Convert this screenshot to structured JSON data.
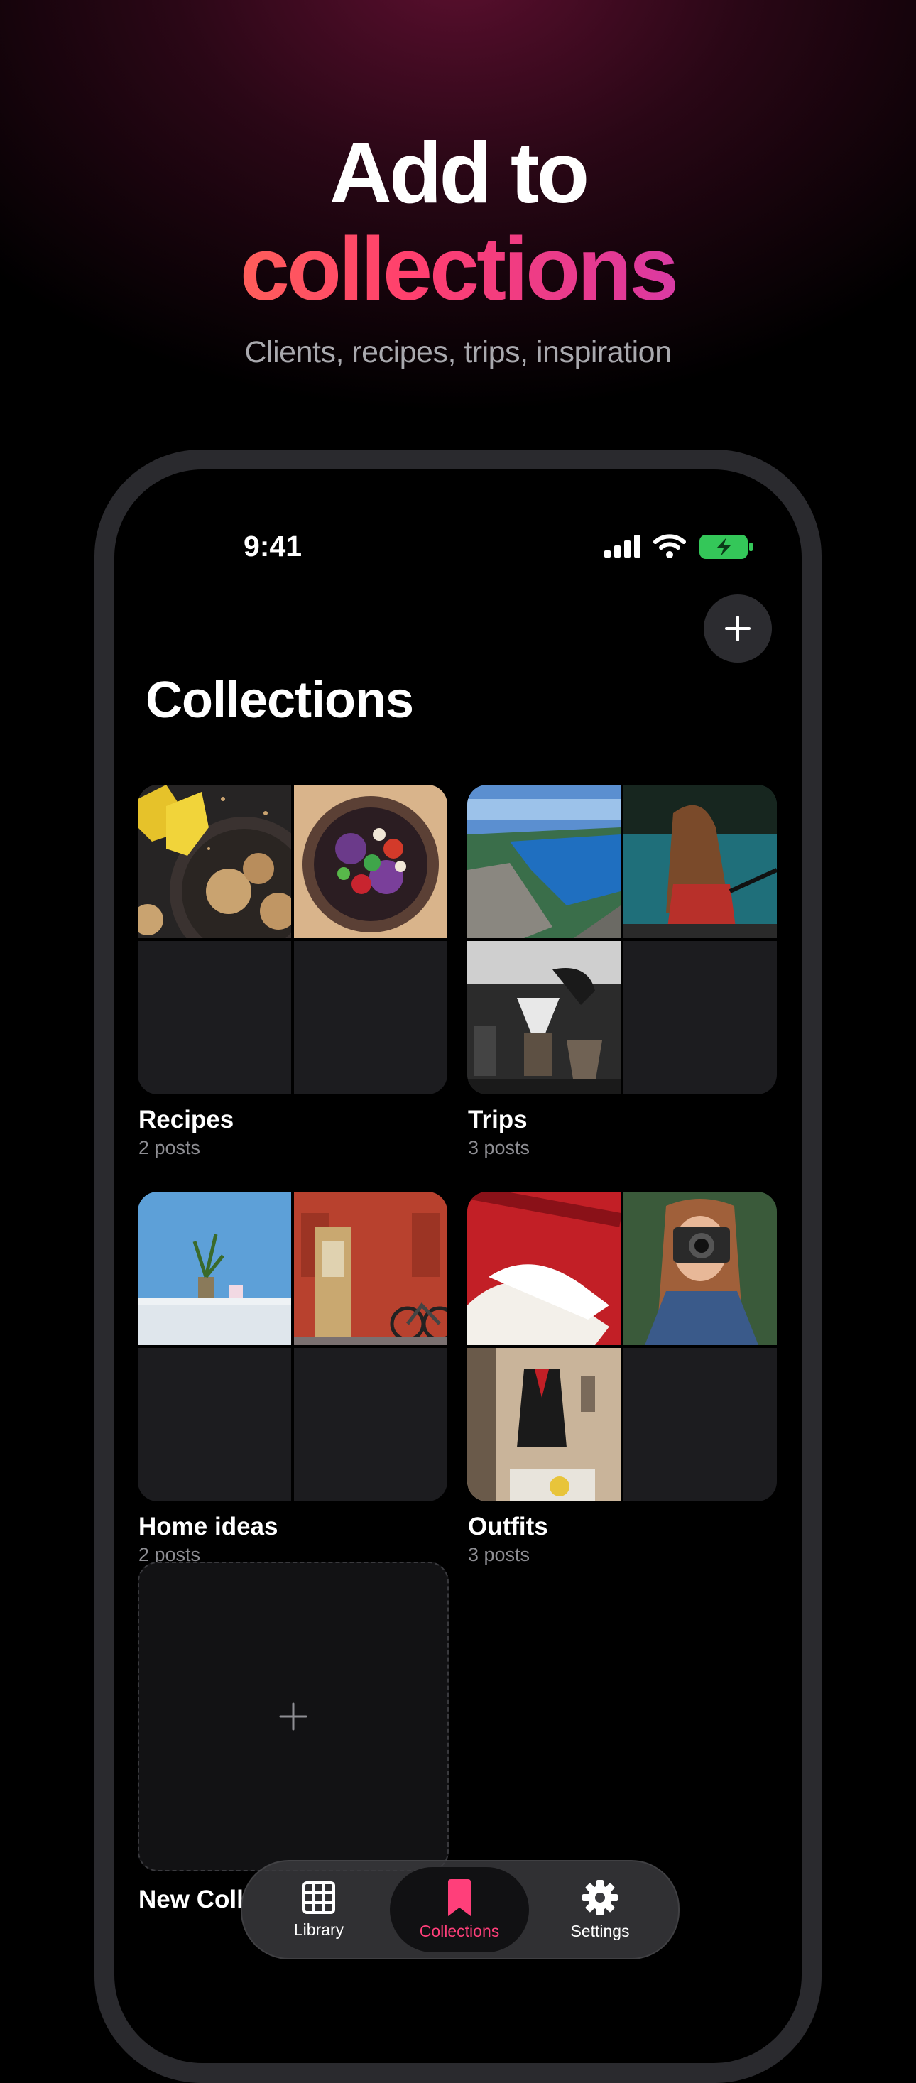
{
  "hero": {
    "line1": "Add to",
    "line2": "collections",
    "subtitle": "Clients, recipes, trips, inspiration"
  },
  "status_bar": {
    "time": "9:41"
  },
  "page": {
    "title": "Collections"
  },
  "collections": [
    {
      "name": "Recipes",
      "count": "2 posts"
    },
    {
      "name": "Trips",
      "count": "3 posts"
    },
    {
      "name": "Home ideas",
      "count": "2 posts"
    },
    {
      "name": "Outfits",
      "count": "3 posts"
    }
  ],
  "new_collection": {
    "label": "New Coll"
  },
  "tabs": [
    {
      "label": "Library",
      "icon": "grid-icon"
    },
    {
      "label": "Collections",
      "icon": "bookmark-icon",
      "active": true
    },
    {
      "label": "Settings",
      "icon": "gear-icon"
    }
  ],
  "colors": {
    "accent": "#ff3f7a",
    "battery": "#34c759",
    "card_bg": "#1c1c1f"
  }
}
